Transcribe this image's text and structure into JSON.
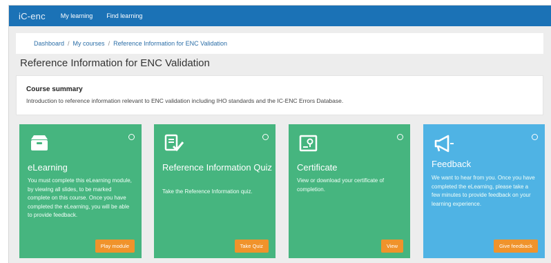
{
  "navbar": {
    "brand": "iC-enc",
    "links": [
      "My learning",
      "Find learning"
    ]
  },
  "breadcrumb": {
    "items": [
      "Dashboard",
      "My courses",
      "Reference Information for ENC Validation"
    ],
    "separator": "/"
  },
  "page": {
    "title": "Reference Information for ENC Validation"
  },
  "summary": {
    "heading": "Course summary",
    "text": "Introduction to reference information relevant to ENC validation including IHO standards and the IC-ENC Errors Database."
  },
  "cards": [
    {
      "icon": "inbox-tray-icon",
      "title": "eLearning",
      "description": "You must complete this eLearning module, by viewing all slides, to be marked complete on this course. Once you have completed the eLearning, you will be able to provide feedback.",
      "button": "Play module",
      "color": "#46b57f"
    },
    {
      "icon": "checklist-icon",
      "title": "Reference Information Quiz",
      "description": "Take the Reference Information quiz.",
      "button": "Take Quiz",
      "color": "#46b57f"
    },
    {
      "icon": "certificate-icon",
      "title": "Certificate",
      "description": "View or download your certificate of completion.",
      "button": "View",
      "color": "#46b57f"
    },
    {
      "icon": "megaphone-icon",
      "title": "Feedback",
      "description": "We want to hear from you. Once you have completed the eLearning, please take a few minutes to provide feedback on your learning experience.",
      "button": "Give feedback",
      "color": "#4fb3e4"
    }
  ],
  "colors": {
    "navbar": "#1b72b6",
    "card_green": "#46b57f",
    "card_blue": "#4fb3e4",
    "button_orange": "#f0932b"
  }
}
